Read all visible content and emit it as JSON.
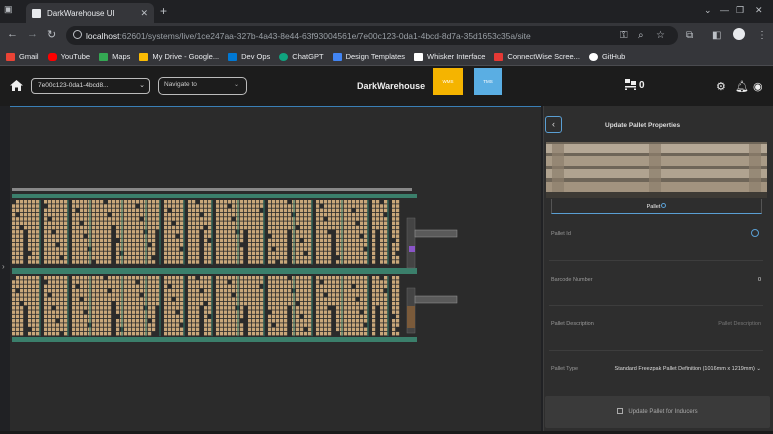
{
  "browser": {
    "tab_title": "DarkWarehouse UI",
    "tab_close": "✕",
    "new_tab": "+",
    "url_host": "localhost",
    "url_rest": ":62601/systems/live/1ce247aa-327b-4a43-8e44-63f93004561e/7e00c123-0da1-4bcd-8d7a-35d1653c35a/site",
    "window_controls": [
      "⌄",
      "—",
      "❐",
      "✕"
    ],
    "bookmarks": [
      {
        "label": "Gmail",
        "color": "#ea4335"
      },
      {
        "label": "YouTube",
        "color": "#ff0000"
      },
      {
        "label": "Maps",
        "color": "#34a853"
      },
      {
        "label": "My Drive - Google...",
        "color": "#fbbc04"
      },
      {
        "label": "Dev Ops",
        "color": "#0078d4"
      },
      {
        "label": "ChatGPT",
        "color": "#10a37f"
      },
      {
        "label": "Design Templates",
        "color": "#4285f4"
      },
      {
        "label": "Whisker Interface",
        "color": "#ffffff"
      },
      {
        "label": "ConnectWise Scree...",
        "color": "#e53935"
      },
      {
        "label": "GitHub",
        "color": "#ffffff"
      }
    ]
  },
  "app": {
    "system_select": "7e00c123-0da1-4bcd8...",
    "navigate_placeholder": "Navigate to",
    "brand": "DarkWarehouse",
    "wms_label": "WMS",
    "tms_label": "TMS",
    "pallet_count": "0",
    "accent_wms": "#f5b400",
    "accent_tms": "#5aaee3"
  },
  "panel": {
    "title": "Update Pallet Properties",
    "tab_label": "Pallet",
    "fields": [
      {
        "label": "Pallet Id",
        "value": ""
      },
      {
        "label": "Barcode Number",
        "value": "0"
      },
      {
        "label": "Pallet Description",
        "value": "Pallet Description"
      },
      {
        "label": "Pallet Type",
        "value": "Standard Freezpak Pallet Definition (1016mm x 1219mm) ⌄"
      }
    ],
    "update_button": "Update Pallet for Inducers"
  }
}
